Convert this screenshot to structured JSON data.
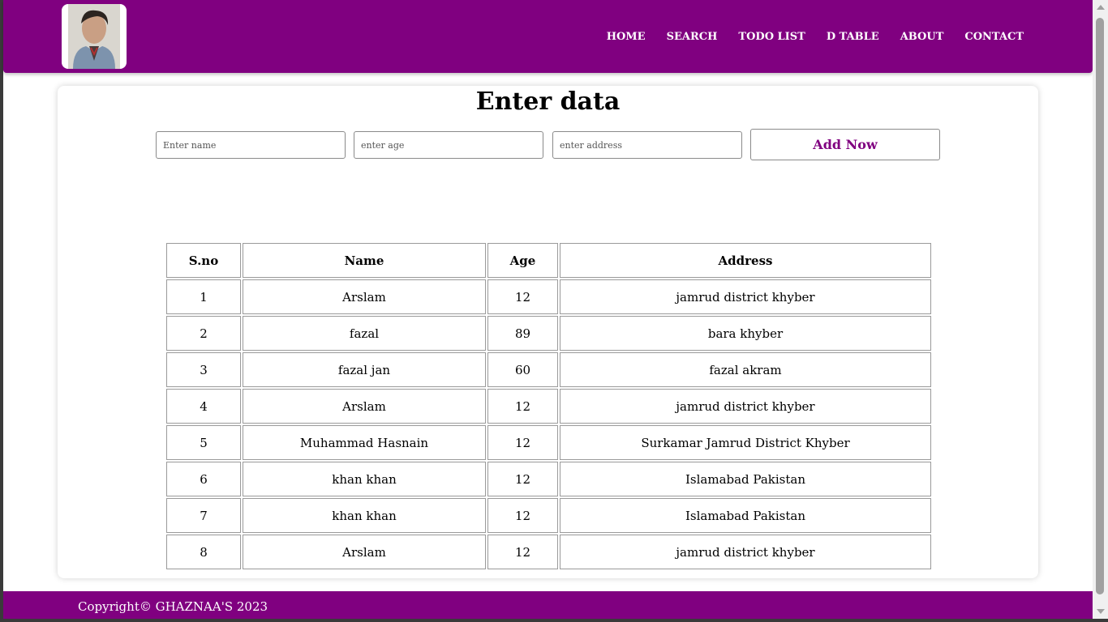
{
  "navbar": {
    "avatar_icon": "profile-photo",
    "links": [
      "HOME",
      "SEARCH",
      "TODO LIST",
      "D TABLE",
      "ABOUT",
      "CONTACT"
    ]
  },
  "form": {
    "title": "Enter data",
    "name_placeholder": "Enter name",
    "age_placeholder": "enter age",
    "address_placeholder": "enter address",
    "name_value": "",
    "age_value": "",
    "address_value": "",
    "submit_label": "Add Now"
  },
  "table": {
    "headers": [
      "S.no",
      "Name",
      "Age",
      "Address"
    ],
    "rows": [
      [
        "1",
        "Arslam",
        "12",
        "jamrud district khyber"
      ],
      [
        "2",
        "fazal",
        "89",
        "bara khyber"
      ],
      [
        "3",
        "fazal jan",
        "60",
        "fazal akram"
      ],
      [
        "4",
        "Arslam",
        "12",
        "jamrud district khyber"
      ],
      [
        "5",
        "Muhammad Hasnain",
        "12",
        "Surkamar Jamrud District Khyber"
      ],
      [
        "6",
        "khan khan",
        "12",
        "Islamabad Pakistan"
      ],
      [
        "7",
        "khan khan",
        "12",
        "Islamabad Pakistan"
      ],
      [
        "8",
        "Arslam",
        "12",
        "jamrud district khyber"
      ]
    ]
  },
  "footer": {
    "copyright": "Copyright© GHAZNAA'S 2023"
  },
  "colors": {
    "brand": "#800080",
    "background": "#ffffff"
  }
}
